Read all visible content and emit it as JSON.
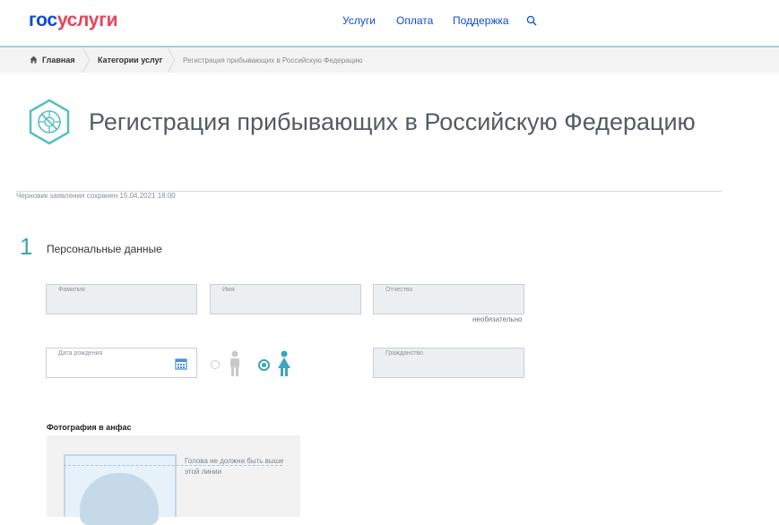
{
  "header": {
    "logo_part1": "гос",
    "logo_part2": "услуги",
    "nav": [
      "Услуги",
      "Оплата",
      "Поддержка"
    ]
  },
  "breadcrumb": {
    "items": [
      "Главная",
      "Категории услуг",
      "Регистрация прибывающих в Российскую Федерацию"
    ]
  },
  "page": {
    "title": "Регистрация прибывающих в Российскую Федерацию",
    "draft_status": "Черновик заявления сохранен 15.04.2021 18:00"
  },
  "step": {
    "number": "1",
    "title": "Персональные данные"
  },
  "form": {
    "surname_label": "Фамилия",
    "name_label": "Имя",
    "patronymic_label": "Отчество",
    "optional_note": "необязательно",
    "birthdate_label": "Дата рождения",
    "citizenship_label": "Гражданство",
    "gender_selected": "female"
  },
  "photo": {
    "title": "Фотография в анфас",
    "hint": "Голова не должна быть выше этой линии"
  },
  "colors": {
    "brand_blue": "#0d4cd3",
    "brand_red": "#ee3f58",
    "accent_teal": "#3aa9a8"
  }
}
